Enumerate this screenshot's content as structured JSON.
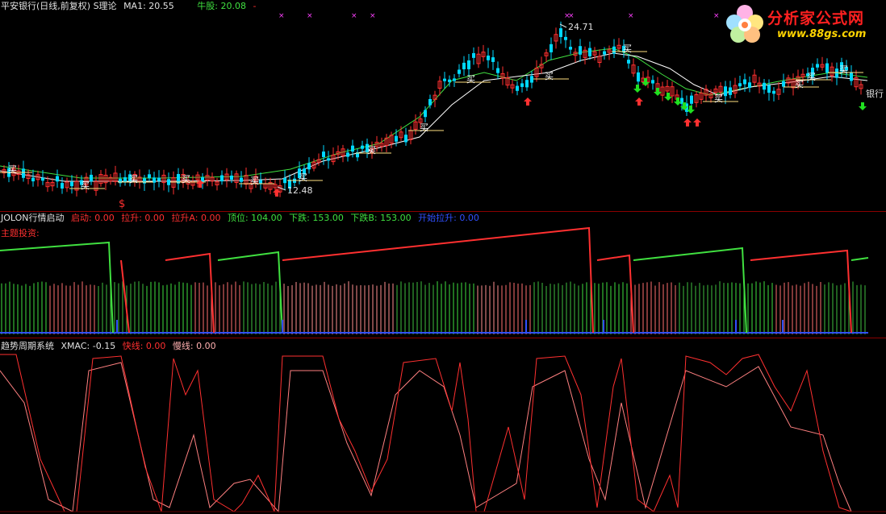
{
  "pane1": {
    "title": "平安银行(日线,前复权) S理论",
    "ma1_label": "MA1: 20.55",
    "bull_label": "牛股: 20.08",
    "dash": "-",
    "max_price": "24.71",
    "min_price": "12.48",
    "stock_tag": "银行",
    "s_marker": "$",
    "buy_char": "买"
  },
  "pane2": {
    "name": "JOLON行情启动",
    "indicators": [
      {
        "label": "启动: 0.00",
        "color": "#ff3030"
      },
      {
        "label": "拉升: 0.00",
        "color": "#ff3030"
      },
      {
        "label": "拉升A: 0.00",
        "color": "#ff3030"
      },
      {
        "label": "顶位: 104.00",
        "color": "#40e040"
      },
      {
        "label": "下跌: 153.00",
        "color": "#40e040"
      },
      {
        "label": "下跌B: 153.00",
        "color": "#40e040"
      },
      {
        "label": "开始拉升: 0.00",
        "color": "#3050ff"
      }
    ],
    "subtitle": "主题投资:"
  },
  "pane3": {
    "name": "趋势周期系统",
    "xmac": "XMAC: -0.15",
    "fast": "快线: 0.00",
    "slow": "慢线: 0.00"
  },
  "logo": {
    "title": "分析家公式网",
    "url": "www.88gs.com"
  },
  "colors": {
    "up": "#ff3030",
    "down": "#00d8ff",
    "ma_white": "#ffffff",
    "ma_green": "#40e040",
    "magenta": "#ff40ff",
    "buy_line": "#ffe080",
    "divider": "#8b0000"
  }
}
